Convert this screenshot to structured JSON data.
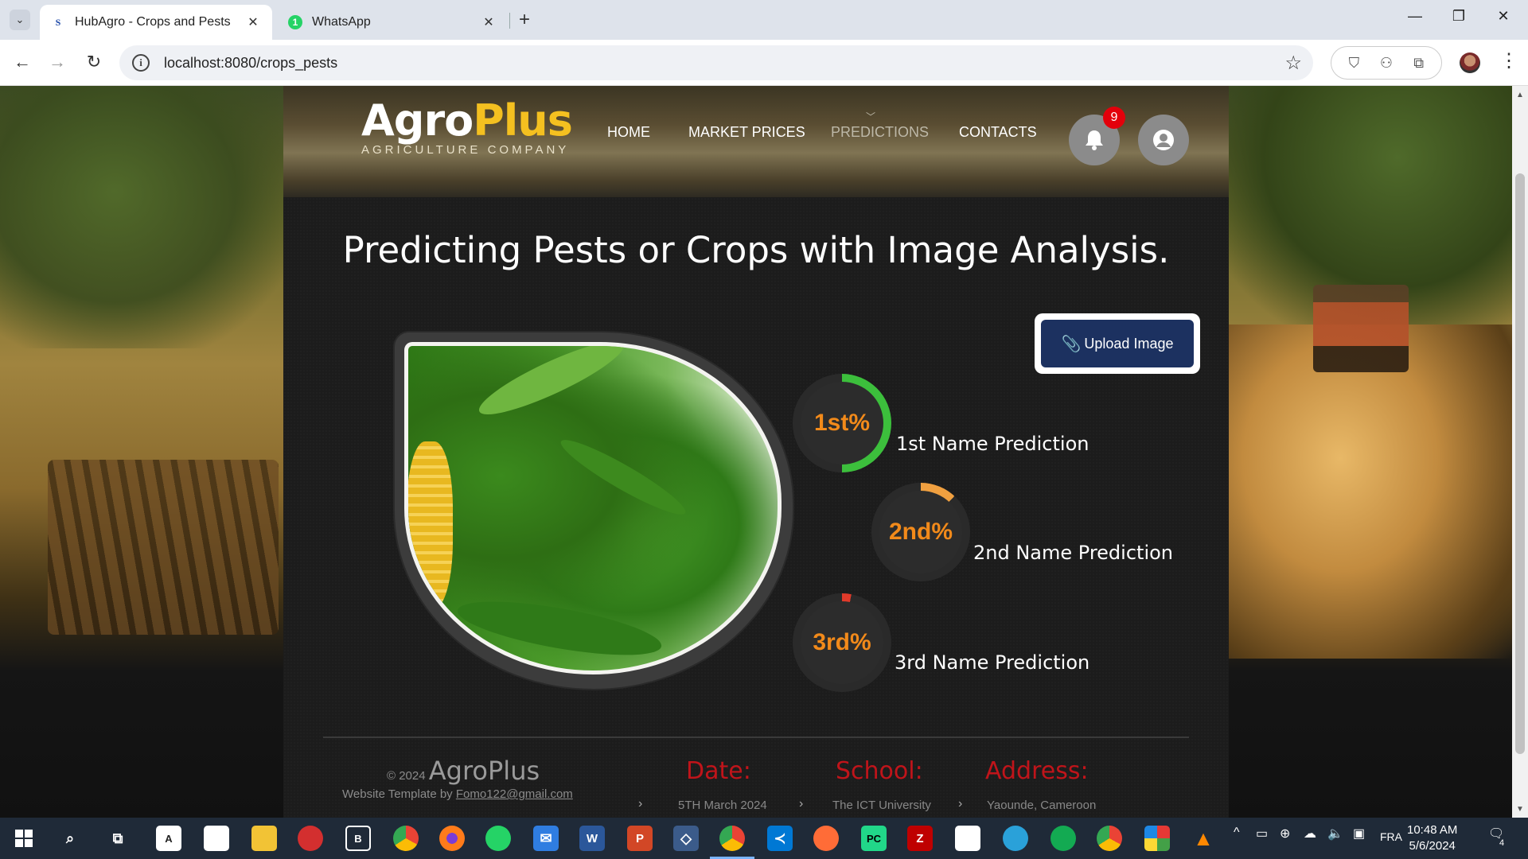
{
  "browser": {
    "tabs": [
      {
        "title": "HubAgro - Crops and Pests",
        "favicon": "S",
        "active": true
      },
      {
        "title": "WhatsApp",
        "favicon": "1",
        "active": false
      }
    ],
    "url": "localhost:8080/crops_pests"
  },
  "header": {
    "logo_main_a": "Agro",
    "logo_main_b": "Plus",
    "logo_sub": "AGRICULTURE COMPANY",
    "nav": [
      "HOME",
      "MARKET PRICES",
      "PREDICTIONS",
      "CONTACTS"
    ],
    "active_nav": "PREDICTIONS",
    "notification_count": "9"
  },
  "main": {
    "title": "Predicting Pests or Crops with Image Analysis.",
    "upload_label": "Upload Image",
    "image_icon": "corn-field-image",
    "predictions": [
      {
        "rank": "1st%",
        "label": "1st Name Prediction",
        "progress": 0.5,
        "color": "#3cbf3c"
      },
      {
        "rank": "2nd%",
        "label": "2nd Name Prediction",
        "progress": 0.12,
        "color": "#f0a040"
      },
      {
        "rank": "3rd%",
        "label": "3rd Name Prediction",
        "progress": 0.03,
        "color": "#e03a2a"
      }
    ]
  },
  "footer": {
    "copyright_year": "© 2024",
    "brand": "AgroPlus",
    "template_prefix": "Website Template by",
    "template_email": "Fomo122@gmail.com",
    "date_heading": "Date:",
    "date_value": "5TH March 2024",
    "school_heading": "School:",
    "school_value": "The ICT University",
    "address_heading": "Address:",
    "address_value": "Yaounde, Cameroon"
  },
  "taskbar": {
    "lang": "FRA",
    "time": "10:48 AM",
    "date": "5/6/2024",
    "notification_count": "4"
  }
}
